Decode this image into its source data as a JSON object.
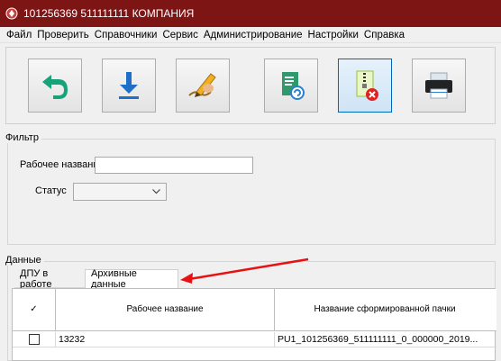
{
  "window": {
    "title": "101256369 511111111 КОМПАНИЯ"
  },
  "menu": [
    "Файл",
    "Проверить",
    "Справочники",
    "Сервис",
    "Администрирование",
    "Настройки",
    "Справка"
  ],
  "toolbar": {
    "buttons": [
      {
        "name": "back",
        "icon": "undo-arrow-icon"
      },
      {
        "name": "download",
        "icon": "download-icon"
      },
      {
        "name": "sign",
        "icon": "pen-sign-icon"
      },
      {
        "name": "report",
        "icon": "document-refresh-icon"
      },
      {
        "name": "archive-delete",
        "icon": "zip-file-delete-icon",
        "active": true
      },
      {
        "name": "print",
        "icon": "printer-icon"
      }
    ]
  },
  "filter": {
    "group_label": "Фильтр",
    "work_name_label": "Рабочее название",
    "work_name_value": "",
    "status_label": "Статус",
    "status_value": ""
  },
  "data_group": {
    "label": "Данные",
    "tabs": [
      "ДПУ в работе",
      "Архивные данные"
    ],
    "active_tab": 1
  },
  "table": {
    "headers": [
      "✓",
      "Рабочее название",
      "Название сформированной пачки"
    ],
    "rows": [
      {
        "checked": false,
        "work_name": "13232",
        "package_name": "PU1_101256369_511111111_0_000000_2019..."
      }
    ]
  },
  "colors": {
    "titlebar": "#7d1515",
    "arrow": "#e81010"
  }
}
